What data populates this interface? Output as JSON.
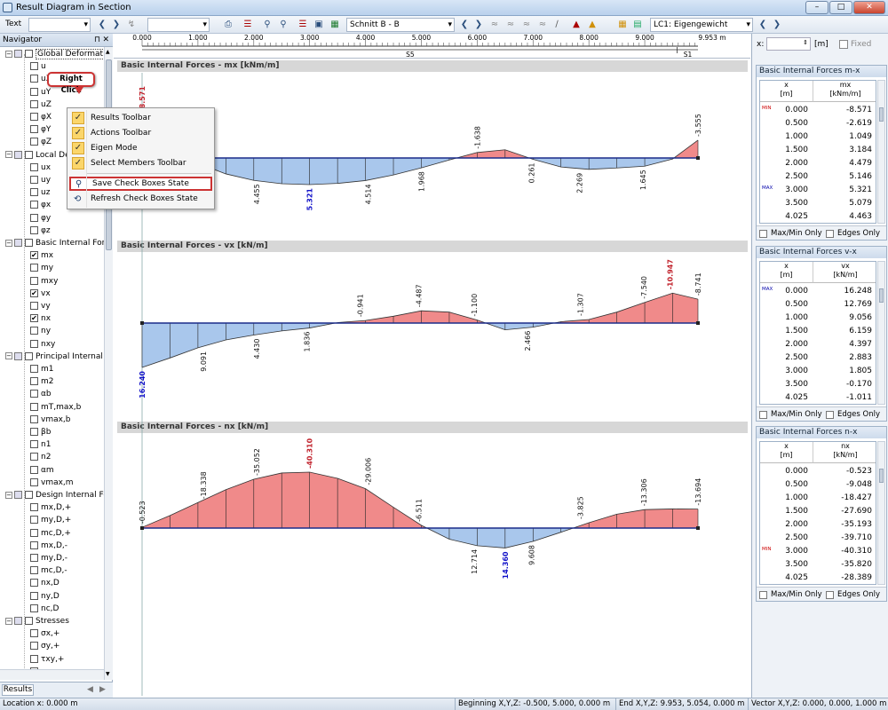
{
  "window": {
    "title": "Result Diagram in Section"
  },
  "toolbar": {
    "text_combo": "Text",
    "section_combo": "Schnitt B - B",
    "loadcase_combo": "LC1: Eigengewicht"
  },
  "navigator": {
    "title": "Navigator",
    "tab": "Results",
    "items": [
      {
        "kind": "group",
        "label": "Global Deformatio",
        "checked": false,
        "highlight": true
      },
      {
        "kind": "leaf",
        "label": "u",
        "checked": false
      },
      {
        "kind": "leaf",
        "label": "uX",
        "checked": false
      },
      {
        "kind": "leaf",
        "label": "uY",
        "checked": false
      },
      {
        "kind": "leaf",
        "label": "uZ",
        "checked": false
      },
      {
        "kind": "leaf",
        "label": "φX",
        "checked": false
      },
      {
        "kind": "leaf",
        "label": "φY",
        "checked": false
      },
      {
        "kind": "leaf",
        "label": "φZ",
        "checked": false
      },
      {
        "kind": "group",
        "label": "Local Defo",
        "checked": false
      },
      {
        "kind": "leaf",
        "label": "ux",
        "checked": false
      },
      {
        "kind": "leaf",
        "label": "uy",
        "checked": false
      },
      {
        "kind": "leaf",
        "label": "uz",
        "checked": false
      },
      {
        "kind": "leaf",
        "label": "φx",
        "checked": false
      },
      {
        "kind": "leaf",
        "label": "φy",
        "checked": false
      },
      {
        "kind": "leaf",
        "label": "φz",
        "checked": false
      },
      {
        "kind": "group",
        "label": "Basic Internal Forc",
        "checked": false
      },
      {
        "kind": "leaf",
        "label": "mx",
        "checked": true
      },
      {
        "kind": "leaf",
        "label": "my",
        "checked": false
      },
      {
        "kind": "leaf",
        "label": "mxy",
        "checked": false
      },
      {
        "kind": "leaf",
        "label": "vx",
        "checked": true
      },
      {
        "kind": "leaf",
        "label": "vy",
        "checked": false
      },
      {
        "kind": "leaf",
        "label": "nx",
        "checked": true
      },
      {
        "kind": "leaf",
        "label": "ny",
        "checked": false
      },
      {
        "kind": "leaf",
        "label": "nxy",
        "checked": false
      },
      {
        "kind": "group",
        "label": "Principal Internal F",
        "checked": false
      },
      {
        "kind": "leaf",
        "label": "m1",
        "checked": false
      },
      {
        "kind": "leaf",
        "label": "m2",
        "checked": false
      },
      {
        "kind": "leaf",
        "label": "αb",
        "checked": false
      },
      {
        "kind": "leaf",
        "label": "mT,max,b",
        "checked": false
      },
      {
        "kind": "leaf",
        "label": "vmax,b",
        "checked": false
      },
      {
        "kind": "leaf",
        "label": "βb",
        "checked": false
      },
      {
        "kind": "leaf",
        "label": "n1",
        "checked": false
      },
      {
        "kind": "leaf",
        "label": "n2",
        "checked": false
      },
      {
        "kind": "leaf",
        "label": "αm",
        "checked": false
      },
      {
        "kind": "leaf",
        "label": "vmax,m",
        "checked": false
      },
      {
        "kind": "group",
        "label": "Design Internal Fo",
        "checked": false
      },
      {
        "kind": "leaf",
        "label": "mx,D,+",
        "checked": false
      },
      {
        "kind": "leaf",
        "label": "my,D,+",
        "checked": false
      },
      {
        "kind": "leaf",
        "label": "mc,D,+",
        "checked": false
      },
      {
        "kind": "leaf",
        "label": "mx,D,-",
        "checked": false
      },
      {
        "kind": "leaf",
        "label": "my,D,-",
        "checked": false
      },
      {
        "kind": "leaf",
        "label": "mc,D,-",
        "checked": false
      },
      {
        "kind": "leaf",
        "label": "nx,D",
        "checked": false
      },
      {
        "kind": "leaf",
        "label": "ny,D",
        "checked": false
      },
      {
        "kind": "leaf",
        "label": "nc,D",
        "checked": false
      },
      {
        "kind": "group",
        "label": "Stresses",
        "checked": false
      },
      {
        "kind": "leaf",
        "label": "σx,+",
        "checked": false
      },
      {
        "kind": "leaf",
        "label": "σy,+",
        "checked": false
      },
      {
        "kind": "leaf",
        "label": "τxy,+",
        "checked": false
      },
      {
        "kind": "leaf",
        "label": "σx,-",
        "checked": false
      }
    ]
  },
  "context_menu": {
    "bubble": "Right Click",
    "items": [
      {
        "label": "Results Toolbar",
        "checked": true
      },
      {
        "label": "Actions Toolbar",
        "checked": true
      },
      {
        "label": "Eigen Mode",
        "checked": true
      },
      {
        "label": "Select Members Toolbar",
        "checked": true
      },
      {
        "label": "Save Check Boxes State",
        "checked": false,
        "icon": "save-state-icon",
        "highlight": true
      },
      {
        "label": "Refresh Check Boxes State",
        "checked": false,
        "icon": "refresh-state-icon"
      }
    ]
  },
  "ruler": {
    "ticks": [
      "0.000",
      "1.000",
      "2.000",
      "3.000",
      "4.000",
      "5.000",
      "6.000",
      "7.000",
      "8.000",
      "9.000",
      "9.953 m"
    ],
    "segments": [
      "S5",
      "S1"
    ]
  },
  "x_field": {
    "label": "x:",
    "unit": "[m]",
    "fixed": "Fixed"
  },
  "chart_data": [
    {
      "type": "area",
      "title": "Basic Internal Forces - mx [kNm/m]",
      "xlabel": "x [m]",
      "x": [
        0,
        0.5,
        1,
        1.5,
        2,
        2.5,
        3,
        3.5,
        4,
        4.5,
        5,
        5.5,
        6,
        6.5,
        7,
        7.5,
        8,
        8.5,
        9,
        9.5,
        9.953
      ],
      "y": [
        -8.571,
        -2.619,
        1.049,
        3.184,
        4.479,
        5.146,
        5.321,
        5.079,
        4.514,
        3.4,
        1.968,
        0.4,
        -1.1,
        -1.638,
        0.261,
        1.8,
        2.269,
        2.0,
        1.645,
        0.2,
        -3.555
      ],
      "labels": [
        {
          "x": 0,
          "text": "-8.571",
          "color": "red"
        },
        {
          "x": 2.05,
          "text": "4.455"
        },
        {
          "x": 3,
          "text": "5.321",
          "color": "blue"
        },
        {
          "x": 4.05,
          "text": "4.514"
        },
        {
          "x": 5,
          "text": "1.968"
        },
        {
          "x": 6,
          "text": "-1.638"
        },
        {
          "x": 6.97,
          "text": "0.261"
        },
        {
          "x": 7.83,
          "text": "2.269"
        },
        {
          "x": 8.97,
          "text": "1.645"
        },
        {
          "x": 9.953,
          "text": "-3.555"
        }
      ]
    },
    {
      "type": "area",
      "title": "Basic Internal Forces - vx [kN/m]",
      "xlabel": "x [m]",
      "x": [
        0,
        0.5,
        1,
        1.5,
        2,
        2.5,
        3,
        3.5,
        4,
        4.5,
        5,
        5.5,
        6,
        6.5,
        7,
        7.5,
        8,
        8.5,
        9,
        9.5,
        9.953
      ],
      "y": [
        16.24,
        12.769,
        9.056,
        6.159,
        4.397,
        2.883,
        1.805,
        -0.17,
        -0.941,
        -2.5,
        -4.487,
        -4.0,
        -1.1,
        2.466,
        1.5,
        -0.5,
        -1.307,
        -4.0,
        -7.54,
        -10.947,
        -8.741
      ],
      "labels": [
        {
          "x": 0,
          "text": "16.240",
          "color": "blue"
        },
        {
          "x": 1.1,
          "text": "9.091"
        },
        {
          "x": 2.05,
          "text": "4.430"
        },
        {
          "x": 2.95,
          "text": "1.836"
        },
        {
          "x": 3.9,
          "text": "-0.941"
        },
        {
          "x": 4.95,
          "text": "-4.487"
        },
        {
          "x": 5.95,
          "text": "-1.100"
        },
        {
          "x": 6.9,
          "text": "2.466"
        },
        {
          "x": 7.85,
          "text": "-1.307"
        },
        {
          "x": 8.98,
          "text": "-7.540"
        },
        {
          "x": 9.45,
          "text": "-10.947",
          "color": "red"
        },
        {
          "x": 9.953,
          "text": "-8.741"
        }
      ]
    },
    {
      "type": "area",
      "title": "Basic Internal Forces - nx [kN/m]",
      "xlabel": "x [m]",
      "x": [
        0,
        0.5,
        1,
        1.5,
        2,
        2.5,
        3,
        3.5,
        4,
        4.5,
        5,
        5.5,
        6,
        6.5,
        7,
        7.5,
        8,
        8.5,
        9,
        9.5,
        9.953
      ],
      "y": [
        -0.523,
        -9.048,
        -18.427,
        -27.69,
        -35.193,
        -39.71,
        -40.31,
        -35.82,
        -28.389,
        -15,
        -2,
        8,
        12.714,
        14.36,
        9.608,
        3,
        -3.825,
        -10,
        -13.306,
        -13.8,
        -13.694
      ],
      "labels": [
        {
          "x": 0,
          "text": "-0.523"
        },
        {
          "x": 1.1,
          "text": "-18.338"
        },
        {
          "x": 2.05,
          "text": "-35.052"
        },
        {
          "x": 3,
          "text": "-40.310",
          "color": "red"
        },
        {
          "x": 4.05,
          "text": "-29.006"
        },
        {
          "x": 4.95,
          "text": "-6.511"
        },
        {
          "x": 5.95,
          "text": "12.714"
        },
        {
          "x": 6.5,
          "text": "14.360",
          "color": "blue"
        },
        {
          "x": 6.97,
          "text": "9.608"
        },
        {
          "x": 7.85,
          "text": "-3.825"
        },
        {
          "x": 8.98,
          "text": "-13.306"
        },
        {
          "x": 9.953,
          "text": "-13.694"
        }
      ]
    }
  ],
  "tables": [
    {
      "title": "Basic Internal Forces m-x",
      "col_x": "x\n[m]",
      "col_v": "mx\n[kNm/m]",
      "markers": [
        "MIN",
        "MAX"
      ],
      "rows": [
        [
          "0.000",
          "-8.571"
        ],
        [
          "0.500",
          "-2.619"
        ],
        [
          "1.000",
          "1.049"
        ],
        [
          "1.500",
          "3.184"
        ],
        [
          "2.000",
          "4.479"
        ],
        [
          "2.500",
          "5.146"
        ],
        [
          "3.000",
          "5.321"
        ],
        [
          "3.500",
          "5.079"
        ],
        [
          "4.025",
          "4.463"
        ]
      ]
    },
    {
      "title": "Basic Internal Forces v-x",
      "col_x": "x\n[m]",
      "col_v": "vx\n[kN/m]",
      "markers": [
        "MAX"
      ],
      "rows": [
        [
          "0.000",
          "16.248"
        ],
        [
          "0.500",
          "12.769"
        ],
        [
          "1.000",
          "9.056"
        ],
        [
          "1.500",
          "6.159"
        ],
        [
          "2.000",
          "4.397"
        ],
        [
          "2.500",
          "2.883"
        ],
        [
          "3.000",
          "1.805"
        ],
        [
          "3.500",
          "-0.170"
        ],
        [
          "4.025",
          "-1.011"
        ]
      ]
    },
    {
      "title": "Basic Internal Forces n-x",
      "col_x": "x\n[m]",
      "col_v": "nx\n[kN/m]",
      "markers": [
        "MIN"
      ],
      "rows": [
        [
          "0.000",
          "-0.523"
        ],
        [
          "0.500",
          "-9.048"
        ],
        [
          "1.000",
          "-18.427"
        ],
        [
          "1.500",
          "-27.690"
        ],
        [
          "2.000",
          "-35.193"
        ],
        [
          "2.500",
          "-39.710"
        ],
        [
          "3.000",
          "-40.310"
        ],
        [
          "3.500",
          "-35.820"
        ],
        [
          "4.025",
          "-28.389"
        ]
      ]
    }
  ],
  "table_footer": {
    "maxmin": "Max/Min Only",
    "edges": "Edges Only"
  },
  "statusbar": {
    "location": "Location x: 0.000 m",
    "beginning": "Beginning X,Y,Z:  -0.500, 5.000, 0.000 m",
    "end": "End X,Y,Z:  9.953, 5.054, 0.000 m",
    "vector": "Vector X,Y,Z:  0.000, 0.000, 1.000 m"
  },
  "colors": {
    "positive_fill": "#a9c7ec",
    "negative_fill": "#f08a8a",
    "axis": "#1a2c8a",
    "accent_red": "#c0202a",
    "blue_label": "#1010c8"
  }
}
